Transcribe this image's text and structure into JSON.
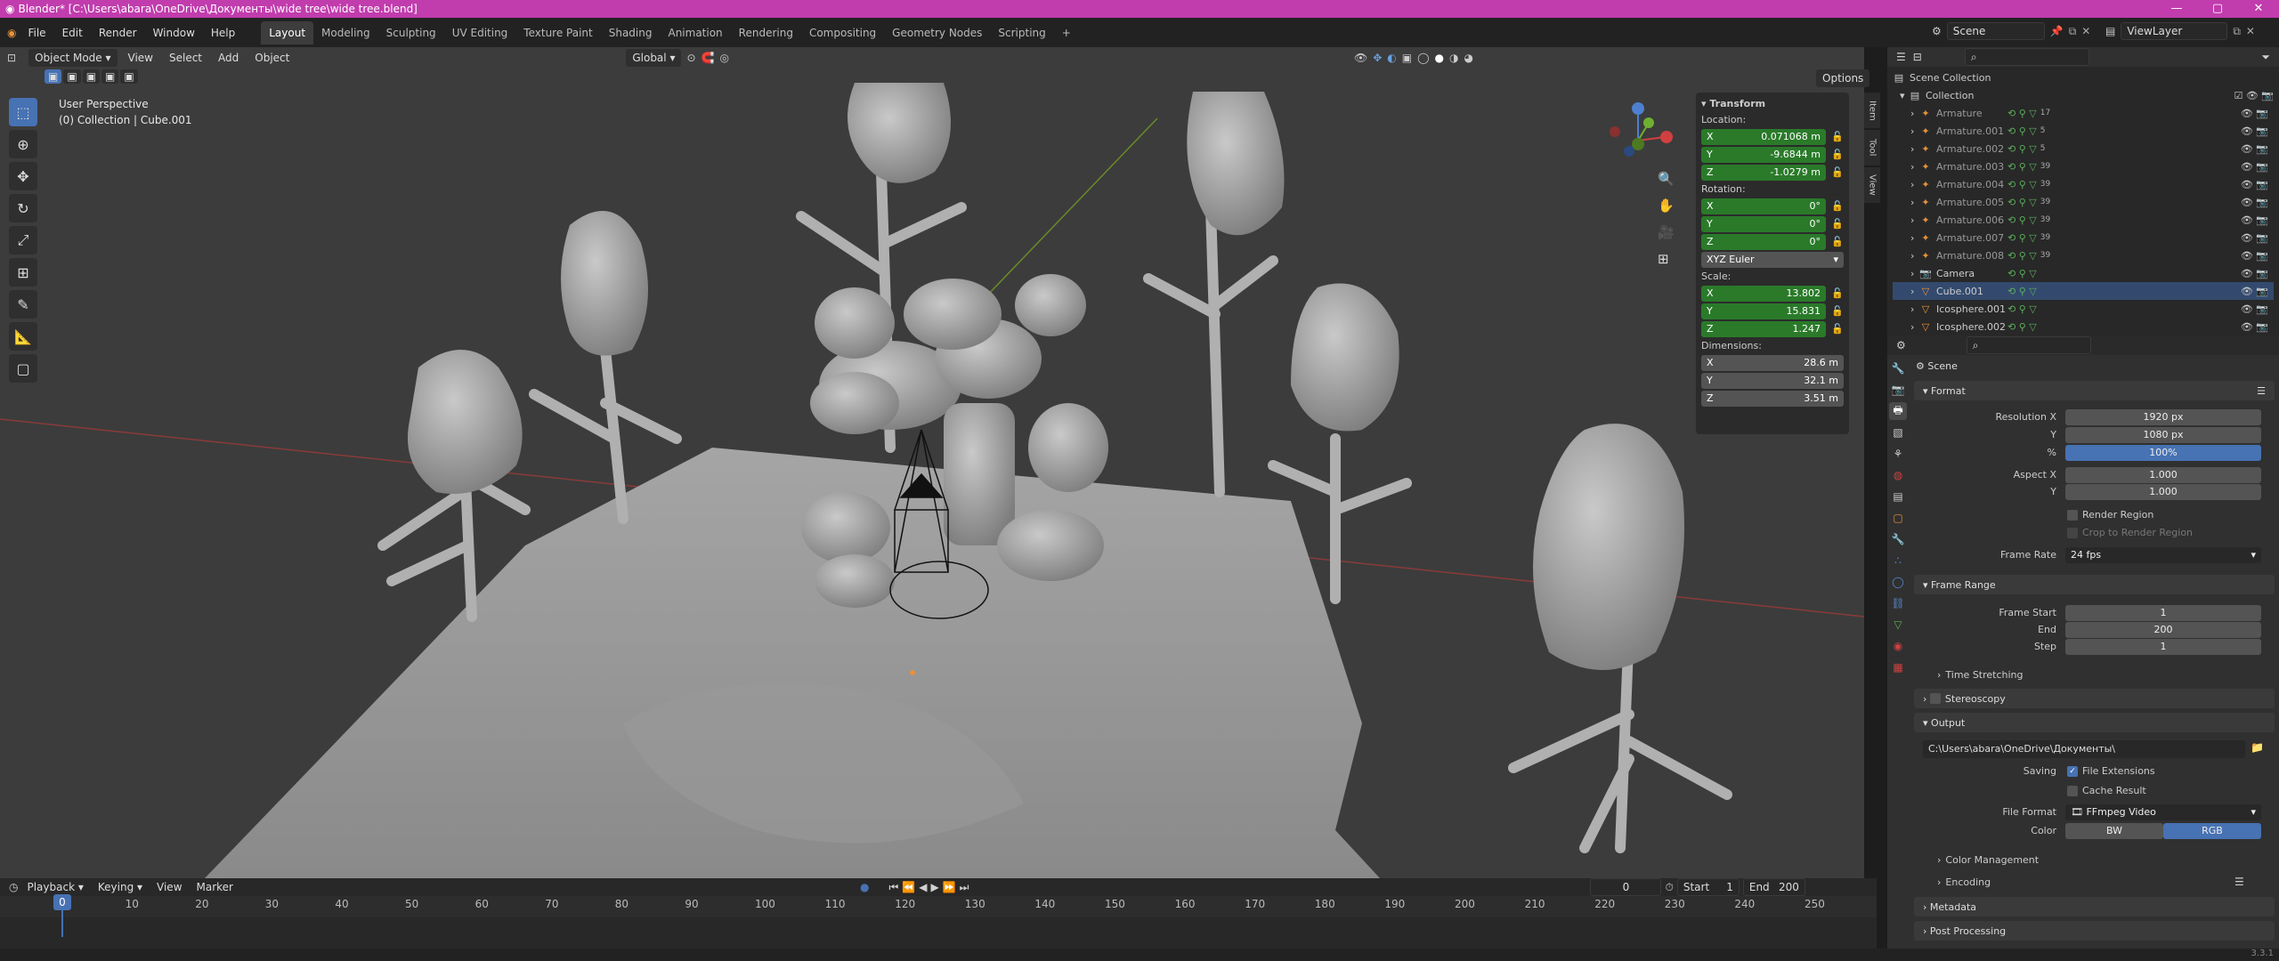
{
  "titlebar": {
    "text": "Blender* [C:\\Users\\abara\\OneDrive\\Документы\\wide tree\\wide tree.blend]",
    "controls": [
      "—",
      "▢",
      "✕"
    ]
  },
  "menu": [
    "File",
    "Edit",
    "Render",
    "Window",
    "Help"
  ],
  "workspaces": [
    "Layout",
    "Modeling",
    "Sculpting",
    "UV Editing",
    "Texture Paint",
    "Shading",
    "Animation",
    "Rendering",
    "Compositing",
    "Geometry Nodes",
    "Scripting"
  ],
  "active_workspace": "Layout",
  "add_workspace": "+",
  "scene": "Scene",
  "viewlayer": "ViewLayer",
  "viewport": {
    "mode": "Object Mode",
    "menus": [
      "View",
      "Select",
      "Add",
      "Object"
    ],
    "orientation": "Global",
    "options": "Options",
    "perspective": "User Perspective",
    "collection_info": "(0) Collection | Cube.001"
  },
  "npanel": {
    "tabs": [
      "Item",
      "Tool",
      "View"
    ],
    "transform": "Transform",
    "location_label": "Location:",
    "location": [
      {
        "axis": "X",
        "value": "0.071068 m"
      },
      {
        "axis": "Y",
        "value": "-9.6844 m"
      },
      {
        "axis": "Z",
        "value": "-1.0279 m"
      }
    ],
    "rotation_label": "Rotation:",
    "rotation": [
      {
        "axis": "X",
        "value": "0°"
      },
      {
        "axis": "Y",
        "value": "0°"
      },
      {
        "axis": "Z",
        "value": "0°"
      }
    ],
    "rotation_mode": "XYZ Euler",
    "scale_label": "Scale:",
    "scale": [
      {
        "axis": "X",
        "value": "13.802"
      },
      {
        "axis": "Y",
        "value": "15.831"
      },
      {
        "axis": "Z",
        "value": "1.247"
      }
    ],
    "dimensions_label": "Dimensions:",
    "dimensions": [
      {
        "axis": "X",
        "value": "28.6 m"
      },
      {
        "axis": "Y",
        "value": "32.1 m"
      },
      {
        "axis": "Z",
        "value": "3.51 m"
      }
    ]
  },
  "outliner": {
    "root": "Scene Collection",
    "collection": "Collection",
    "items": [
      {
        "name": "Armature",
        "badge": "17"
      },
      {
        "name": "Armature.001",
        "badge": "5"
      },
      {
        "name": "Armature.002",
        "badge": "5"
      },
      {
        "name": "Armature.003",
        "badge": "39"
      },
      {
        "name": "Armature.004",
        "badge": "39"
      },
      {
        "name": "Armature.005",
        "badge": "39"
      },
      {
        "name": "Armature.006",
        "badge": "39"
      },
      {
        "name": "Armature.007",
        "badge": "39"
      },
      {
        "name": "Armature.008",
        "badge": "39"
      },
      {
        "name": "Camera",
        "badge": ""
      },
      {
        "name": "Cube.001",
        "badge": ""
      },
      {
        "name": "Icosphere.001",
        "badge": ""
      },
      {
        "name": "Icosphere.002",
        "badge": ""
      }
    ]
  },
  "props": {
    "context": "Scene",
    "format": "Format",
    "res_x_label": "Resolution X",
    "res_x": "1920 px",
    "res_y_label": "Y",
    "res_y": "1080 px",
    "pct_label": "%",
    "pct": "100%",
    "aspect_x_label": "Aspect X",
    "aspect_x": "1.000",
    "aspect_y_label": "Y",
    "aspect_y": "1.000",
    "render_region": "Render Region",
    "crop": "Crop to Render Region",
    "frame_rate_label": "Frame Rate",
    "frame_rate": "24 fps",
    "frame_range": "Frame Range",
    "frame_start_label": "Frame Start",
    "frame_start": "1",
    "end_label": "End",
    "end": "200",
    "step_label": "Step",
    "step": "1",
    "time_stretching": "Time Stretching",
    "stereoscopy": "Stereoscopy",
    "output": "Output",
    "output_path": "C:\\Users\\abara\\OneDrive\\Документы\\",
    "saving_label": "Saving",
    "file_extensions": "File Extensions",
    "cache_result": "Cache Result",
    "file_format_label": "File Format",
    "file_format": "FFmpeg Video",
    "color_label": "Color",
    "color_bw": "BW",
    "color_rgb": "RGB",
    "color_management": "Color Management",
    "encoding": "Encoding",
    "metadata": "Metadata",
    "post_processing": "Post Processing"
  },
  "timeline": {
    "menus": [
      "Playback",
      "Keying",
      "View",
      "Marker"
    ],
    "current_frame": "0",
    "start_label": "Start",
    "start": "1",
    "end_label": "End",
    "end": "200",
    "ticks": [
      "0",
      "10",
      "20",
      "30",
      "40",
      "50",
      "60",
      "70",
      "80",
      "90",
      "100",
      "110",
      "120",
      "130",
      "140",
      "150",
      "160",
      "170",
      "180",
      "190",
      "200",
      "210",
      "220",
      "230",
      "240",
      "250"
    ]
  },
  "version": "3.3.1"
}
